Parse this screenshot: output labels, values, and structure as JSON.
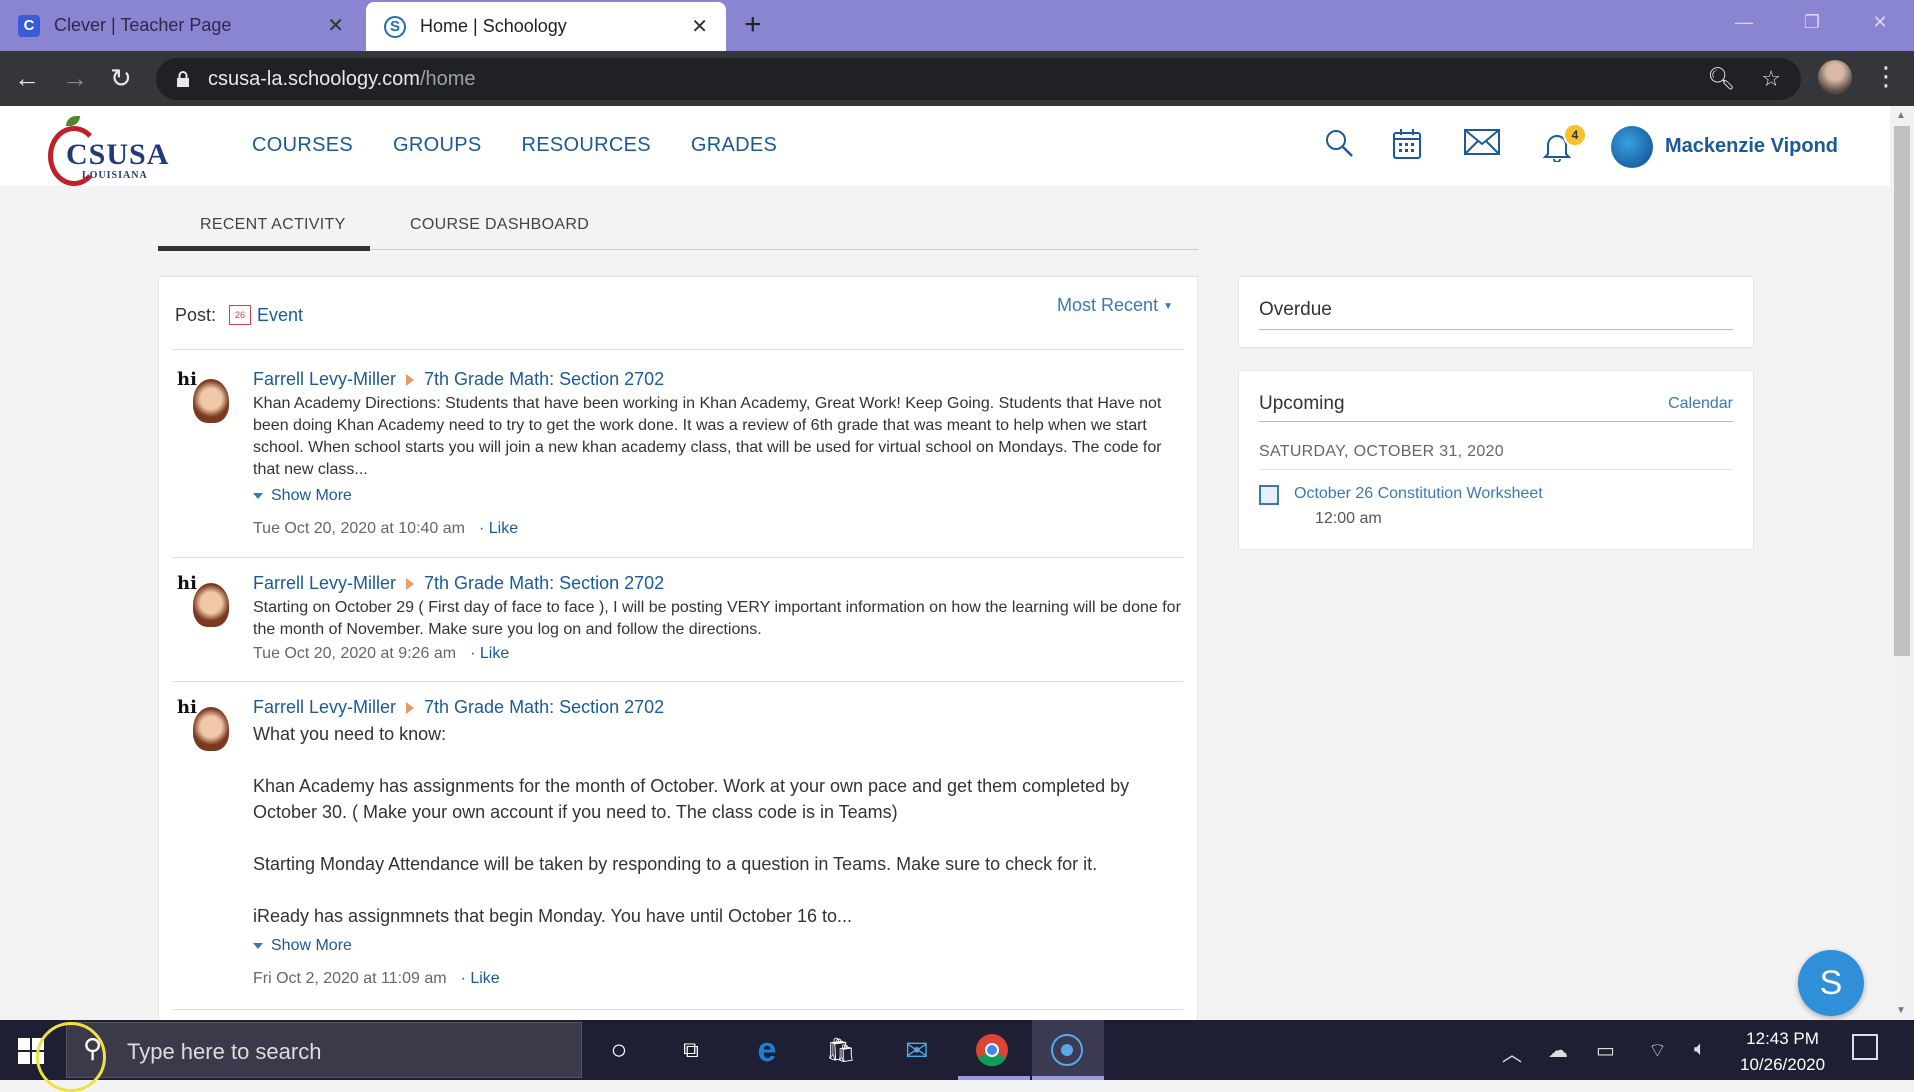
{
  "browser": {
    "tabs": [
      {
        "title": "Clever | Teacher Page",
        "favicon": "C"
      },
      {
        "title": "Home | Schoology",
        "favicon": "S"
      }
    ],
    "url_host": "csusa-la.schoology.com",
    "url_path": "/home"
  },
  "header": {
    "logo_text": "CSUSA",
    "logo_sub": "LOUISIANA",
    "nav": [
      "COURSES",
      "GROUPS",
      "RESOURCES",
      "GRADES"
    ],
    "notification_count": "4",
    "user_name": "Mackenzie Vipond"
  },
  "tabs": {
    "recent": "RECENT ACTIVITY",
    "dashboard": "COURSE DASHBOARD"
  },
  "feed": {
    "post_label": "Post:",
    "calendar_day": "26",
    "event_label": "Event",
    "sort_label": "Most Recent",
    "items": [
      {
        "author": "Farrell Levy-Miller",
        "course": "7th Grade Math: Section 2702",
        "body": "Khan Academy Directions:   Students that have been working in Khan Academy, Great Work! Keep Going. Students that Have not been doing Khan Academy need to try to get the work done. It was a review of 6th grade that was meant to help when we start school.      When school starts you will join a new khan academy class, that will be used for virtual school on Mondays.  The code for that new class...",
        "show_more": "Show More",
        "time": "Tue Oct 20, 2020 at 10:40 am",
        "like": "· Like"
      },
      {
        "author": "Farrell Levy-Miller",
        "course": "7th Grade Math: Section 2702",
        "body": "Starting on October 29 ( First day of face to face ), I will be posting VERY important information on how the learning will be done for the month of November. Make sure you log on and follow the directions.",
        "time": "Tue Oct 20, 2020 at 9:26 am",
        "like": "· Like"
      },
      {
        "author": "Farrell Levy-Miller",
        "course": "7th Grade Math: Section 2702",
        "body_lines": [
          "What you need to know:",
          "",
          "Khan Academy has assignments for the month of October. Work at your own pace and get them completed by October 30. ( Make your own account if you need to. The class code is in Teams)",
          "",
          "Starting Monday Attendance will be taken by responding to a question in Teams. Make sure to check for it.",
          "",
          "iReady has assignmnets that begin Monday. You have until October 16 to..."
        ],
        "show_more": "Show More",
        "time": "Fri Oct 2, 2020 at 11:09 am",
        "like": "· Like"
      }
    ]
  },
  "sidebar": {
    "overdue_title": "Overdue",
    "upcoming_title": "Upcoming",
    "calendar_link": "Calendar",
    "date": "SATURDAY, OCTOBER 31, 2020",
    "event_title": "October 26 Constitution Worksheet",
    "event_time": "12:00 am"
  },
  "fab_label": "S",
  "taskbar": {
    "search_placeholder": "Type here to search",
    "time": "12:43 PM",
    "date": "10/26/2020"
  }
}
